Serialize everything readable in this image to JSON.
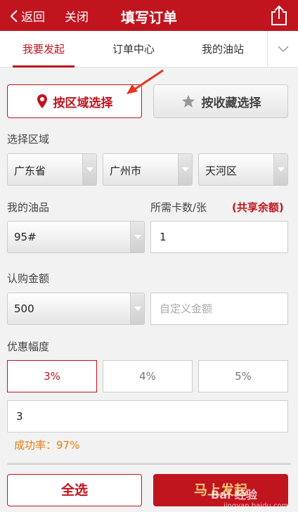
{
  "header": {
    "back_label": "返回",
    "close_label": "关闭",
    "title": "填写订单"
  },
  "tabs": [
    {
      "label": "我要发起",
      "active": true
    },
    {
      "label": "订单中心",
      "active": false
    },
    {
      "label": "我的油站",
      "active": false
    }
  ],
  "location": {
    "by_region_label": "按区域选择",
    "by_favorite_label": "按收藏选择",
    "selected": "by_region"
  },
  "region": {
    "label": "选择区域",
    "province": "广东省",
    "city": "广州市",
    "district": "天河区"
  },
  "product": {
    "label": "我的油品",
    "value": "95#",
    "cards_label": "所需卡数/张",
    "shared_label": "(共享余额)",
    "cards_value": "1"
  },
  "amount": {
    "label": "认购金额",
    "value": "500",
    "custom_placeholder": "自定义金额"
  },
  "discount": {
    "label": "优惠幅度",
    "options": [
      "3%",
      "4%",
      "5%"
    ],
    "selected_index": 0,
    "input_value": "3",
    "success_label": "成功率：",
    "success_value": "97%"
  },
  "footer": {
    "select_all_label": "全选",
    "submit_label": "马上发起"
  },
  "watermark": {
    "text": "Bai 经验",
    "sub": "jingyan.baidu.com"
  },
  "colors": {
    "brand_red": "#c0141f",
    "success_orange": "#e87d0d"
  }
}
